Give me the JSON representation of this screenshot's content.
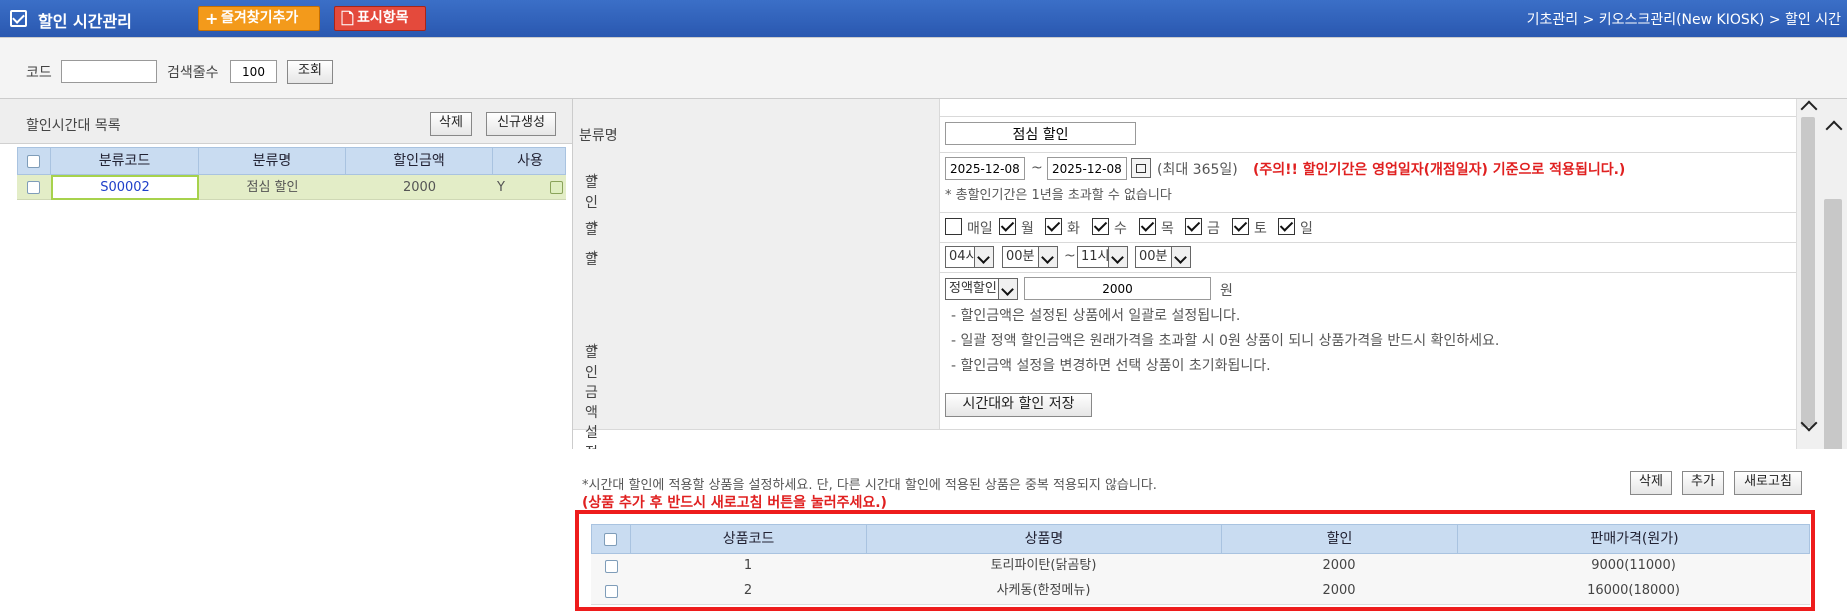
{
  "titlebar": {
    "title": "할인 시간관리",
    "fav_button": "즐겨찾기추가",
    "display_button": "표시항목",
    "breadcrumb": "기초관리 > 키오스크관리(New KIOSK) > 할인 시간"
  },
  "search": {
    "code_label": "코드",
    "code_value": "",
    "count_label": "검색줄수",
    "count_value": "100",
    "search_button": "조회"
  },
  "list": {
    "title": "할인시간대 목록",
    "delete_button": "삭제",
    "new_button": "신규생성",
    "columns": [
      "분류코드",
      "분류명",
      "할인금액",
      "사용"
    ],
    "rows": [
      {
        "code": "S00002",
        "name": "점심 할인",
        "amount": "2000",
        "use": "Y"
      }
    ]
  },
  "form": {
    "name_label": "분류명",
    "name_value": "점심 할인",
    "period_label": "할인기간",
    "period_start": "2025-12-08",
    "period_sep": "~",
    "period_end": "2025-12-08",
    "period_max": "(최대 365일)",
    "period_warning": "(주의!! 할인기간은 영업일자(개점일자) 기준으로 적용됩니다.)",
    "period_note": "* 총할인기간은 1년을 초과할 수 없습니다",
    "days_label": "할인요일 설정",
    "days": [
      {
        "label": "매일",
        "checked": false
      },
      {
        "label": "월",
        "checked": true
      },
      {
        "label": "화",
        "checked": true
      },
      {
        "label": "수",
        "checked": true
      },
      {
        "label": "목",
        "checked": true
      },
      {
        "label": "금",
        "checked": true
      },
      {
        "label": "토",
        "checked": true
      },
      {
        "label": "일",
        "checked": true
      }
    ],
    "time_label": "할인시간 설정",
    "start_hour": "04시",
    "start_min": "00분",
    "time_sep": "~",
    "end_hour": "11시",
    "end_min": "00분",
    "amount_label": "할인금액 설정",
    "amount_type": "정액할인",
    "amount_value": "2000",
    "amount_unit": "원",
    "notes": [
      "- 할인금액은 설정된 상품에서 일괄로 설정됩니다.",
      "- 일괄 정액 할인금액은 원래가격을 초과할 시 0원 상품이 되니 상품가격을 반드시 확인하세요.",
      "- 할인금액 설정을 변경하면 선택 상품이 초기화됩니다."
    ],
    "save_button": "시간대와 할인 저장"
  },
  "products": {
    "instruction": "*시간대 할인에 적용할 상품을 설정하세요. 단, 다른 시간대 할인에 적용된 상품은 중복 적용되지 않습니다.",
    "warning": "(상품 추가 후 반드시 새로고침 버튼을 눌러주세요.)",
    "delete_button": "삭제",
    "add_button": "추가",
    "refresh_button": "새로고침",
    "columns": [
      "상품코드",
      "상품명",
      "할인",
      "판매가격(원가)"
    ],
    "rows": [
      {
        "code": "1",
        "name": "토리파이탄(닭곰탕)",
        "discount": "2000",
        "price": "9000(11000)"
      },
      {
        "code": "2",
        "name": "사케동(한정메뉴)",
        "discount": "2000",
        "price": "16000(18000)"
      }
    ]
  },
  "colors": {
    "titlebar": "#2a58b0",
    "grid_header": "#c9dcf1",
    "selected_row": "#e3edc7",
    "highlight_box": "#ee1c1c",
    "warning_text": "#e02020"
  }
}
